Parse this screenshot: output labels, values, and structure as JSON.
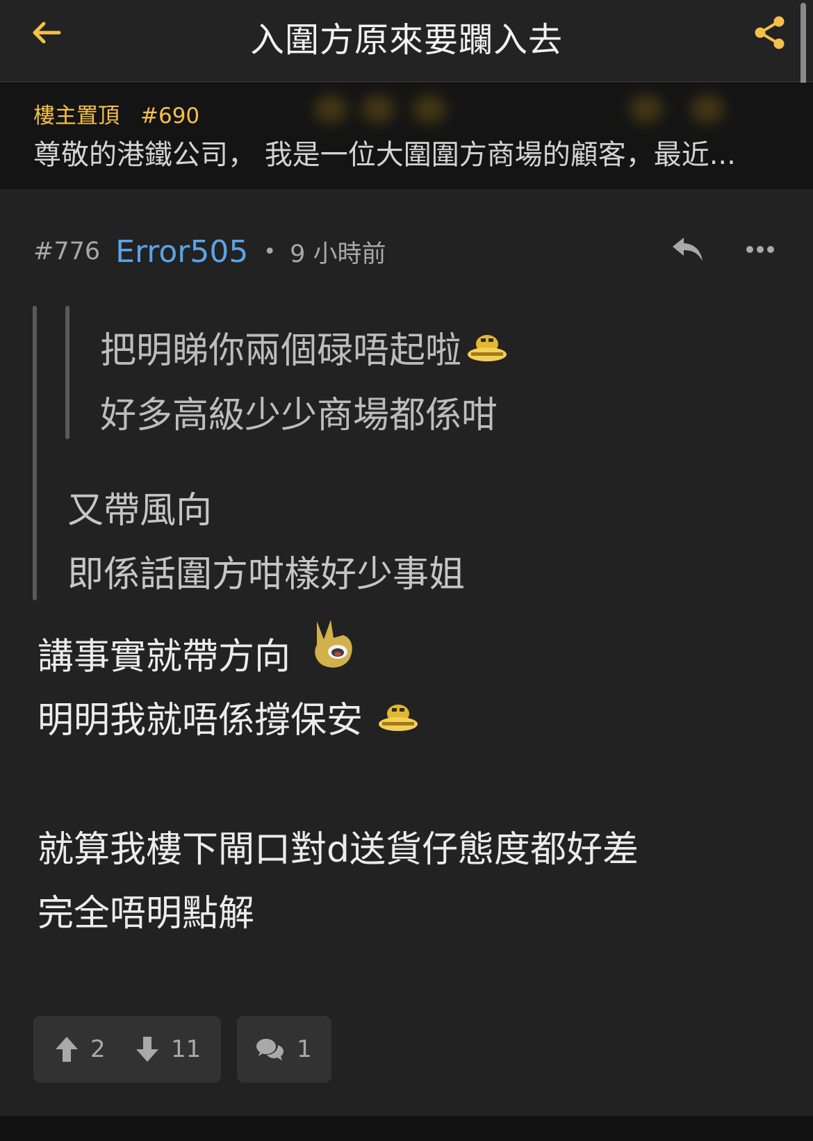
{
  "header": {
    "title": "入圍方原來要躝入去",
    "back_icon": "arrow-left-icon",
    "share_icon": "share-icon",
    "accent": "#f5c04a"
  },
  "pinned": {
    "label": "樓主置頂",
    "floor": "#690",
    "text": "尊敬的港鐵公司， 我是一位大圍圍方商場的顧客，最近..."
  },
  "post": {
    "floor": "#776",
    "username": "Error505",
    "separator": "•",
    "time": "9 小時前",
    "username_color": "#5aa4e6",
    "nested_quote": [
      "把明睇你兩個碌唔起啦",
      "好多高級少少商場都係咁"
    ],
    "quote": [
      "又帶風向",
      "即係話圍方咁樣好少事姐"
    ],
    "body": [
      "講事實就帶方向",
      "明明我就唔係撐保安",
      "就算我樓下閘口對d送貨仔態度都好差",
      "完全唔明點解"
    ],
    "upvotes": "2",
    "downvotes": "11",
    "comments": "1"
  }
}
